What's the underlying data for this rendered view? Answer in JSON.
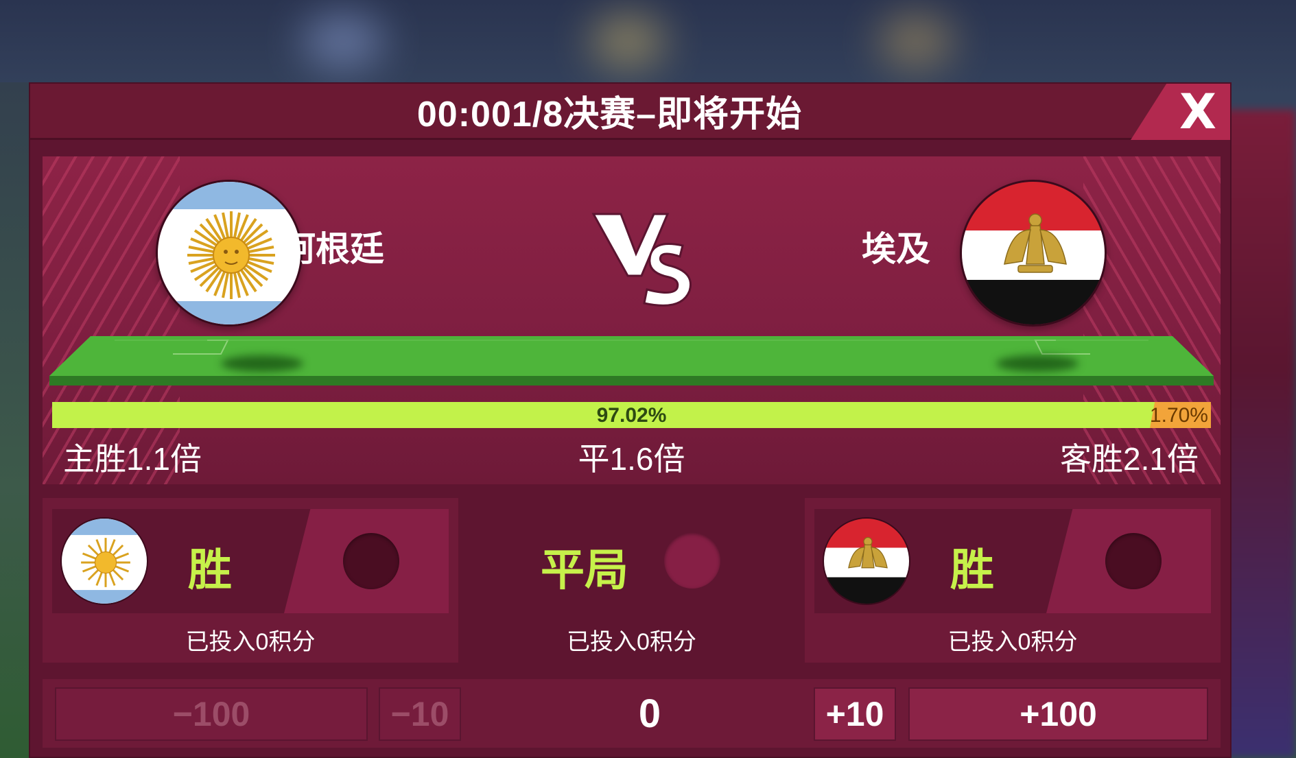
{
  "dialog": {
    "title": "00:001/8决赛–即将开始",
    "close_label": "X"
  },
  "match": {
    "home_team": "阿根廷",
    "away_team": "埃及",
    "vs_label": "VS",
    "home_flag_icon": "argentina-flag-icon",
    "away_flag_icon": "egypt-flag-icon"
  },
  "support_bar": {
    "home_percent_label": "97.02%",
    "away_percent_label": "1.70%",
    "home_fraction": 0.9702,
    "away_fraction": 0.017,
    "home_color": "#c2f24a",
    "away_color": "#f2a43a"
  },
  "odds": {
    "home": "主胜1.1倍",
    "draw": "平1.6倍",
    "away": "客胜2.1倍"
  },
  "bets": {
    "home": {
      "label": "胜",
      "invested": "已投入0积分"
    },
    "draw": {
      "label": "平局",
      "invested": "已投入0积分"
    },
    "away": {
      "label": "胜",
      "invested": "已投入0积分"
    }
  },
  "stake": {
    "minus100": "−100",
    "minus10": "−10",
    "value": "0",
    "plus10": "+10",
    "plus100": "+100"
  },
  "colors": {
    "panel": "#5e1530",
    "accent_green": "#c6f14a",
    "close_bg": "#b2294f"
  }
}
